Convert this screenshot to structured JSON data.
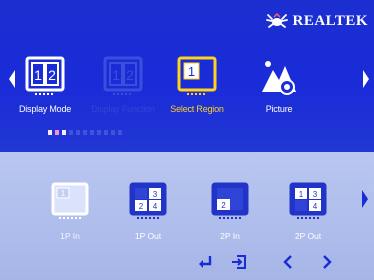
{
  "brand": {
    "name": "REALTEK",
    "logo_icon": "realtek-crab-logo-icon"
  },
  "colors": {
    "top_band": "#1a2bd8",
    "bottom_band": "#aebdec",
    "selected_item": "#ffd21e",
    "disabled_item": "#3448d6",
    "active_dot": "#ff8ad8"
  },
  "menu": {
    "items": [
      {
        "label": "Display Mode",
        "icon": "dual-monitor-icon",
        "state": "normal"
      },
      {
        "label": "Display Function",
        "icon": "dual-monitor-icon",
        "state": "disabled"
      },
      {
        "label": "Select Region",
        "icon": "single-region-monitor-icon",
        "state": "selected"
      },
      {
        "label": "Picture",
        "icon": "picture-landscape-icon",
        "state": "normal"
      }
    ],
    "page_indicator": {
      "count": 11,
      "active_index": 1
    }
  },
  "sub_menu": {
    "items": [
      {
        "label": "1P In",
        "icon": "pip-layout-icon",
        "state": "selected"
      },
      {
        "label": "1P Out",
        "icon": "quad-layout-icon",
        "state": "normal"
      },
      {
        "label": "2P In",
        "icon": "pip-layout-icon",
        "state": "normal"
      },
      {
        "label": "2P Out",
        "icon": "quad-layout-icon",
        "state": "normal"
      }
    ]
  },
  "hints": {
    "enter": "enter-icon",
    "exit": "exit-icon",
    "left": "left-arrow-icon",
    "right": "right-arrow-icon"
  }
}
